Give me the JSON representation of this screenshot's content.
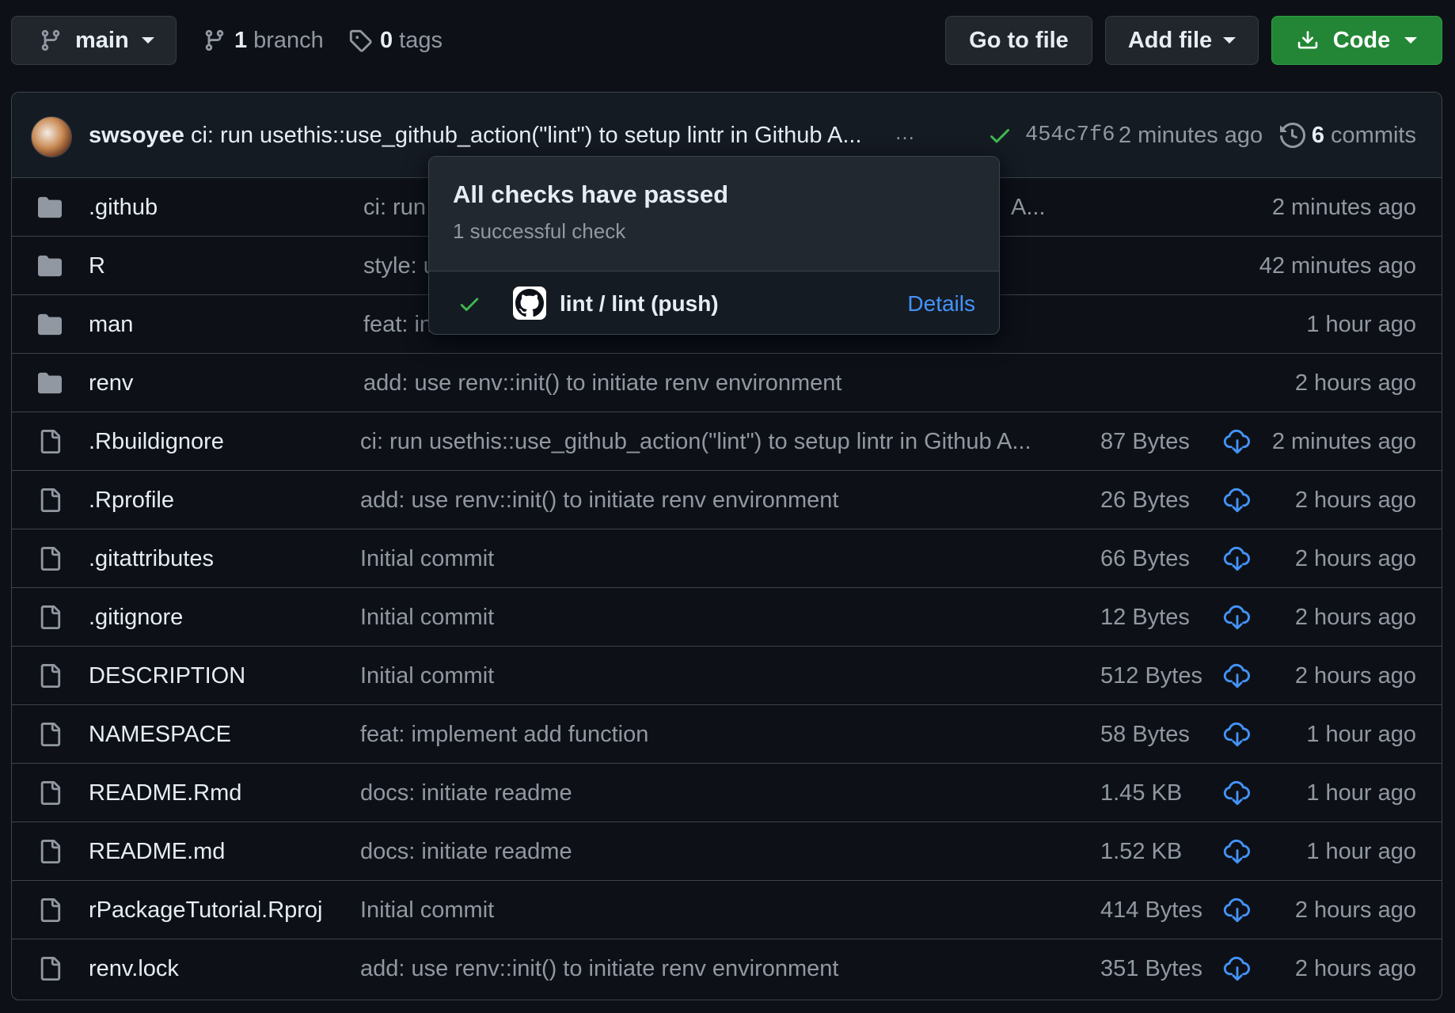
{
  "toolbar": {
    "branch_button": "main",
    "branches_count": "1",
    "branches_label": "branch",
    "tags_count": "0",
    "tags_label": "tags",
    "go_to_file": "Go to file",
    "add_file": "Add file",
    "code": "Code"
  },
  "commit": {
    "author": "swsoyee",
    "message": "ci: run usethis::use_github_action(\"lint\") to setup lintr in Github A...",
    "ellipsis": "…",
    "sha": "454c7f6",
    "time": "2 minutes ago",
    "commits_count": "6",
    "commits_label": "commits"
  },
  "files": [
    {
      "type": "dir",
      "name": ".github",
      "message": "ci: run",
      "message_tail": "A...",
      "size": "",
      "age": "2 minutes ago"
    },
    {
      "type": "dir",
      "name": "R",
      "message": "style: u",
      "size": "",
      "age": "42 minutes ago"
    },
    {
      "type": "dir",
      "name": "man",
      "message": "feat: in",
      "size": "",
      "age": "1 hour ago"
    },
    {
      "type": "dir",
      "name": "renv",
      "message": "add: use renv::init() to initiate renv environment",
      "size": "",
      "age": "2 hours ago"
    },
    {
      "type": "file",
      "name": ".Rbuildignore",
      "message": "ci: run usethis::use_github_action(\"lint\") to setup lintr in Github A...",
      "size": "87 Bytes",
      "age": "2 minutes ago"
    },
    {
      "type": "file",
      "name": ".Rprofile",
      "message": "add: use renv::init() to initiate renv environment",
      "size": "26 Bytes",
      "age": "2 hours ago"
    },
    {
      "type": "file",
      "name": ".gitattributes",
      "message": "Initial commit",
      "size": "66 Bytes",
      "age": "2 hours ago"
    },
    {
      "type": "file",
      "name": ".gitignore",
      "message": "Initial commit",
      "size": "12 Bytes",
      "age": "2 hours ago"
    },
    {
      "type": "file",
      "name": "DESCRIPTION",
      "message": "Initial commit",
      "size": "512 Bytes",
      "age": "2 hours ago"
    },
    {
      "type": "file",
      "name": "NAMESPACE",
      "message": "feat: implement add function",
      "size": "58 Bytes",
      "age": "1 hour ago"
    },
    {
      "type": "file",
      "name": "README.Rmd",
      "message": "docs: initiate readme",
      "size": "1.45 KB",
      "age": "1 hour ago"
    },
    {
      "type": "file",
      "name": "README.md",
      "message": "docs: initiate readme",
      "size": "1.52 KB",
      "age": "1 hour ago"
    },
    {
      "type": "file",
      "name": "rPackageTutorial.Rproj",
      "message": "Initial commit",
      "size": "414 Bytes",
      "age": "2 hours ago"
    },
    {
      "type": "file",
      "name": "renv.lock",
      "message": "add: use renv::init() to initiate renv environment",
      "size": "351 Bytes",
      "age": "2 hours ago"
    }
  ],
  "checks_popover": {
    "title": "All checks have passed",
    "subtitle": "1 successful check",
    "check_name": "lint / lint (push)",
    "details_link": "Details"
  },
  "colors": {
    "background": "#0d1117",
    "code_button": "#238636",
    "link": "#4493f8",
    "success": "#3fb950",
    "muted": "#9198a1"
  }
}
